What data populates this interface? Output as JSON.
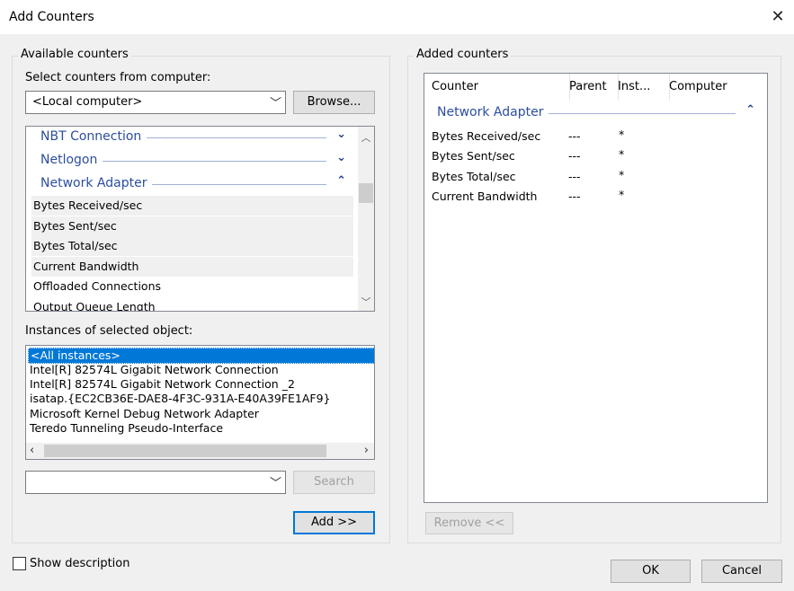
{
  "window": {
    "title": "Add Counters",
    "close_glyph": "✕"
  },
  "available": {
    "legend": "Available counters",
    "computer_label": "Select counters from computer:",
    "computer_value": "<Local computer>",
    "browse_label": "Browse...",
    "objects": [
      {
        "label": "NBT Connection",
        "chevron": "⌄"
      },
      {
        "label": "Netlogon",
        "chevron": "⌄"
      },
      {
        "label": "Network Adapter",
        "chevron": "⌃"
      }
    ],
    "counters": [
      "Bytes Received/sec",
      "Bytes Sent/sec",
      "Bytes Total/sec",
      "Current Bandwidth",
      "Offloaded Connections",
      "Output Queue Length"
    ],
    "instances_label": "Instances of selected object:",
    "instances": [
      "<All instances>",
      "Intel[R] 82574L Gigabit Network Connection",
      "Intel[R] 82574L Gigabit Network Connection _2",
      "isatap.{EC2CB36E-DAE8-4F3C-931A-E40A39FE1AF9}",
      "Microsoft Kernel Debug Network Adapter",
      "Teredo Tunneling Pseudo-Interface"
    ],
    "search_value": "",
    "search_label": "Search",
    "add_label": "Add >>"
  },
  "added": {
    "legend": "Added counters",
    "columns": [
      "Counter",
      "Parent",
      "Inst...",
      "Computer"
    ],
    "group_label": "Network Adapter",
    "group_chevron": "⌃",
    "rows": [
      {
        "counter": "Bytes Received/sec",
        "parent": "---",
        "inst": "*",
        "computer": ""
      },
      {
        "counter": "Bytes Sent/sec",
        "parent": "---",
        "inst": "*",
        "computer": ""
      },
      {
        "counter": "Bytes Total/sec",
        "parent": "---",
        "inst": "*",
        "computer": ""
      },
      {
        "counter": "Current Bandwidth",
        "parent": "---",
        "inst": "*",
        "computer": ""
      }
    ],
    "remove_label": "Remove <<"
  },
  "footer": {
    "show_description_label": "Show description",
    "show_description_checked": false,
    "ok_label": "OK",
    "cancel_label": "Cancel"
  }
}
